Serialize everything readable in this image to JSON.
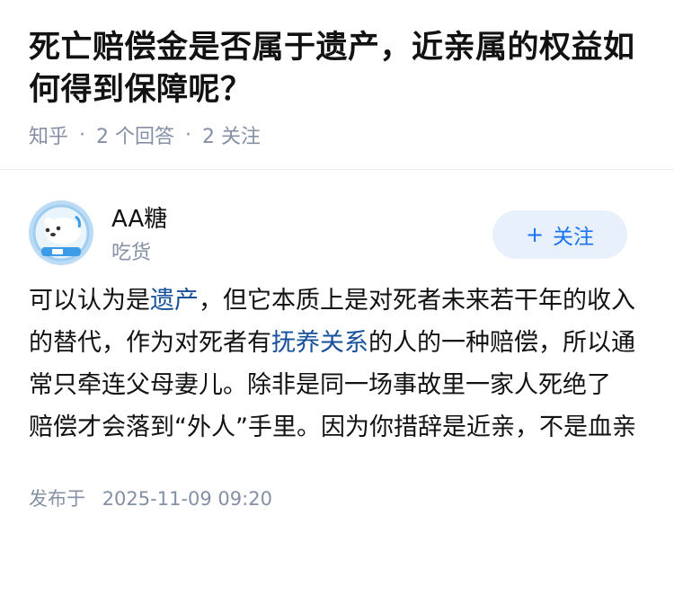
{
  "question": {
    "title": "死亡赔偿金是否属于遗产，近亲属的权益如何得到保障呢？",
    "source": "知乎",
    "answers_count": "2 个回答",
    "followers_count": "2 关注"
  },
  "answer": {
    "author_name": "AA糖",
    "author_tag": "吃货",
    "follow_label": "关注",
    "follow_plus": "+",
    "content": {
      "p1": "可以认为是",
      "link1": "遗产",
      "p2": "，但它本质上是对死者未来若干年的收入的替代，作为对死者有",
      "link2": "抚养关系",
      "p3": "的人的一种赔偿，所以通常只牵连父母妻儿。除非是同一场事故里一家人死绝了 赔偿才会落到“外人”手里。因为你措辞是近亲，不是血亲"
    },
    "published_label": "发布于",
    "published_time": "2025-11-09 09:20"
  },
  "colors": {
    "link": "#175199",
    "accent": "#1772f6",
    "meta": "#8590a6"
  }
}
